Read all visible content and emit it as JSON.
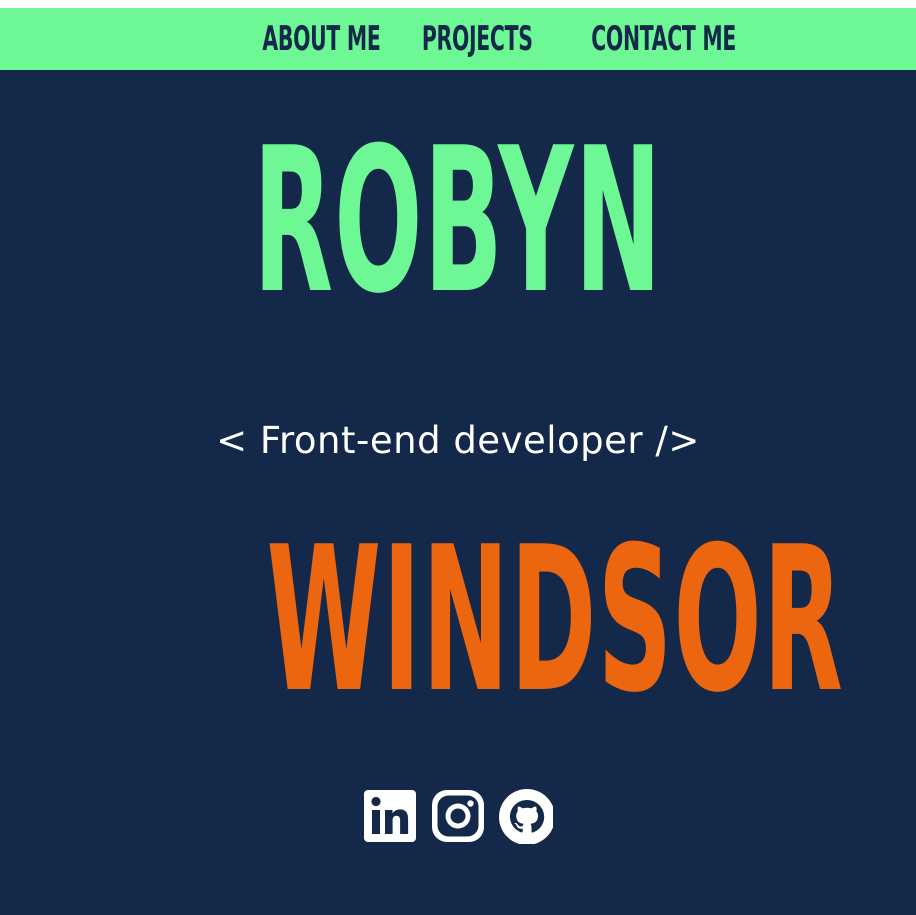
{
  "nav": {
    "items": [
      {
        "label": "ABOUT ME"
      },
      {
        "label": "PROJECTS"
      },
      {
        "label": "CONTACT ME"
      }
    ]
  },
  "hero": {
    "first_name": "ROBYN",
    "tagline": "< Front-end developer />",
    "last_name": "WINDSOR"
  },
  "socials": [
    {
      "icon": "linkedin-icon"
    },
    {
      "icon": "instagram-icon"
    },
    {
      "icon": "github-icon"
    }
  ],
  "colors": {
    "background": "#14284a",
    "accent_green": "#6df795",
    "accent_orange": "#ec6610",
    "text_white": "#ffffff"
  }
}
